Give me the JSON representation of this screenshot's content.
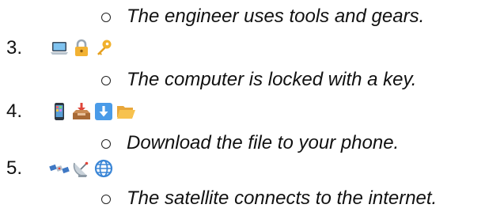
{
  "items": [
    {
      "sub": "The engineer uses tools and gears."
    },
    {
      "number": "3.",
      "icons": [
        "laptop-icon",
        "lock-icon",
        "key-icon"
      ],
      "sub": "The computer is locked with a key."
    },
    {
      "number": "4.",
      "icons": [
        "mobile-phone-icon",
        "inbox-tray-icon",
        "down-arrow-icon",
        "open-folder-icon"
      ],
      "sub": "Download the file to your phone."
    },
    {
      "number": "5.",
      "icons": [
        "satellite-icon",
        "satellite-dish-icon",
        "globe-icon"
      ],
      "sub": "The satellite connects to the internet."
    }
  ]
}
